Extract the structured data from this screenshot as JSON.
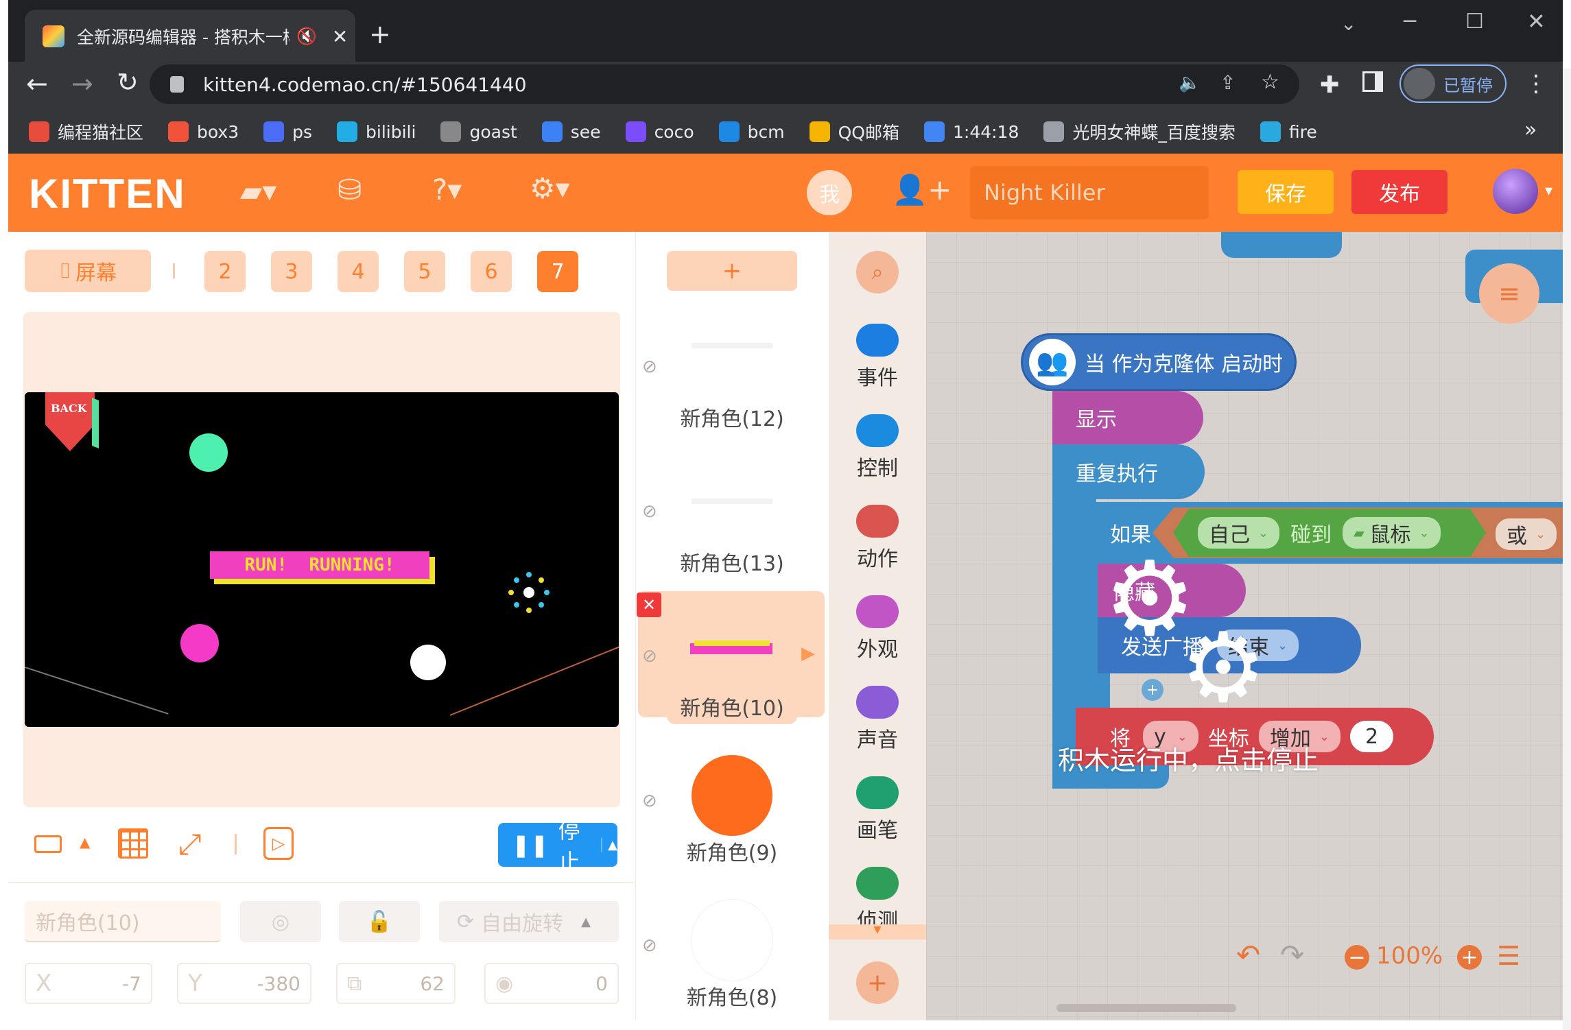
{
  "browser": {
    "tab_title": "全新源码编辑器 - 搭积木一样",
    "url": "kitten4.codemao.cn/#150641440",
    "profile_label": "已暂停",
    "bookmarks": [
      {
        "label": "编程猫社区",
        "color": "#e84c3d"
      },
      {
        "label": "box3",
        "color": "#f0523a"
      },
      {
        "label": "ps",
        "color": "#4a6cf7"
      },
      {
        "label": "bilibili",
        "color": "#23ade5"
      },
      {
        "label": "goast",
        "color": "#888888"
      },
      {
        "label": "see",
        "color": "#3b82f6"
      },
      {
        "label": "coco",
        "color": "#7c4dff"
      },
      {
        "label": "bcm",
        "color": "#1e88e5"
      },
      {
        "label": "QQ邮箱",
        "color": "#f5b400"
      },
      {
        "label": "1:44:18",
        "color": "#4285f4"
      },
      {
        "label": "光明女神蝶_百度搜索",
        "color": "#9aa0a6"
      },
      {
        "label": "fire",
        "color": "#2aa8e0"
      }
    ],
    "bookmarks_more": "»"
  },
  "app": {
    "logo": "KITTEN",
    "me_button": "我",
    "project_name": "Night Killer",
    "save_label": "保存",
    "publish_label": "发布",
    "accent": "#fe7f2d"
  },
  "stage": {
    "screen_label": "屏幕",
    "screens": [
      "2",
      "3",
      "4",
      "5",
      "6",
      "7"
    ],
    "active_screen": "7",
    "back_label": "BACK",
    "banner_text": "RUN!  RUNNING!",
    "stop_label": "停止"
  },
  "props": {
    "name": "新角色(10)",
    "rotation": "自由旋转",
    "x_label": "X",
    "x_value": "-7",
    "y_label": "Y",
    "y_value": "-380",
    "size_value": "62",
    "direction_value": "0"
  },
  "sprites": {
    "add_label": "+",
    "items": [
      {
        "name": "新角色(12)"
      },
      {
        "name": "新角色(13)"
      },
      {
        "name": "新角色(10)"
      },
      {
        "name": "新角色(9)"
      },
      {
        "name": "新角色(8)"
      }
    ]
  },
  "categories": [
    {
      "label": "事件",
      "color": "#1b7ee0"
    },
    {
      "label": "控制",
      "color": "#1b8be0"
    },
    {
      "label": "动作",
      "color": "#d9534f"
    },
    {
      "label": "外观",
      "color": "#c255c6"
    },
    {
      "label": "声音",
      "color": "#8a5cd6"
    },
    {
      "label": "画笔",
      "color": "#20a070"
    },
    {
      "label": "侦测",
      "color": "#2f9e5a"
    }
  ],
  "blocks": {
    "hat": "当 作为克隆体 启动时",
    "show": "显示",
    "repeat": "重复执行",
    "if": "如果",
    "self": "自己",
    "touch": "碰到",
    "mouse": "鼠标",
    "or": "或",
    "hide": "隐藏",
    "send": "发送广播",
    "end": "结束",
    "set": "将",
    "var_y": "y",
    "coord": "坐标",
    "increase": "增加",
    "amount": "2",
    "running_overlay": "积木运行中，点击停止",
    "zoom": "100%"
  }
}
